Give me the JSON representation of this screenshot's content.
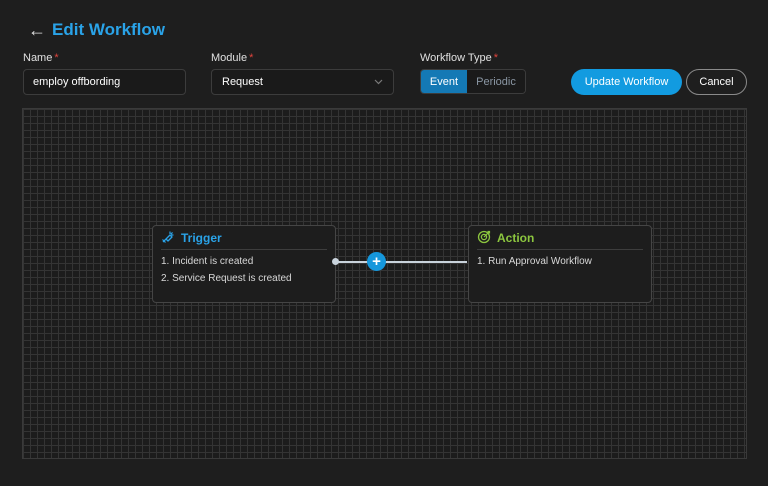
{
  "header": {
    "back_symbol": "←",
    "title": "Edit Workflow"
  },
  "form": {
    "name": {
      "label": "Name",
      "required_mark": "*",
      "value": "employ offbording"
    },
    "module": {
      "label": "Module",
      "required_mark": "*",
      "value": "Request"
    },
    "workflow_type": {
      "label": "Workflow Type",
      "required_mark": "*",
      "options": [
        "Event",
        "Periodic"
      ],
      "selected": "Event"
    }
  },
  "actions": {
    "update_label": "Update Workflow",
    "cancel_label": "Cancel"
  },
  "canvas": {
    "trigger": {
      "title": "Trigger",
      "items": [
        "1. Incident is created",
        "2. Service Request is created"
      ],
      "accent": "#2aa3e8"
    },
    "action": {
      "title": "Action",
      "items": [
        "1. Run Approval Workflow"
      ],
      "accent": "#8cc63f"
    },
    "add_symbol": "+"
  },
  "colors": {
    "accent": "#129be0",
    "required": "#e0443c",
    "background": "#1e1e1e"
  }
}
